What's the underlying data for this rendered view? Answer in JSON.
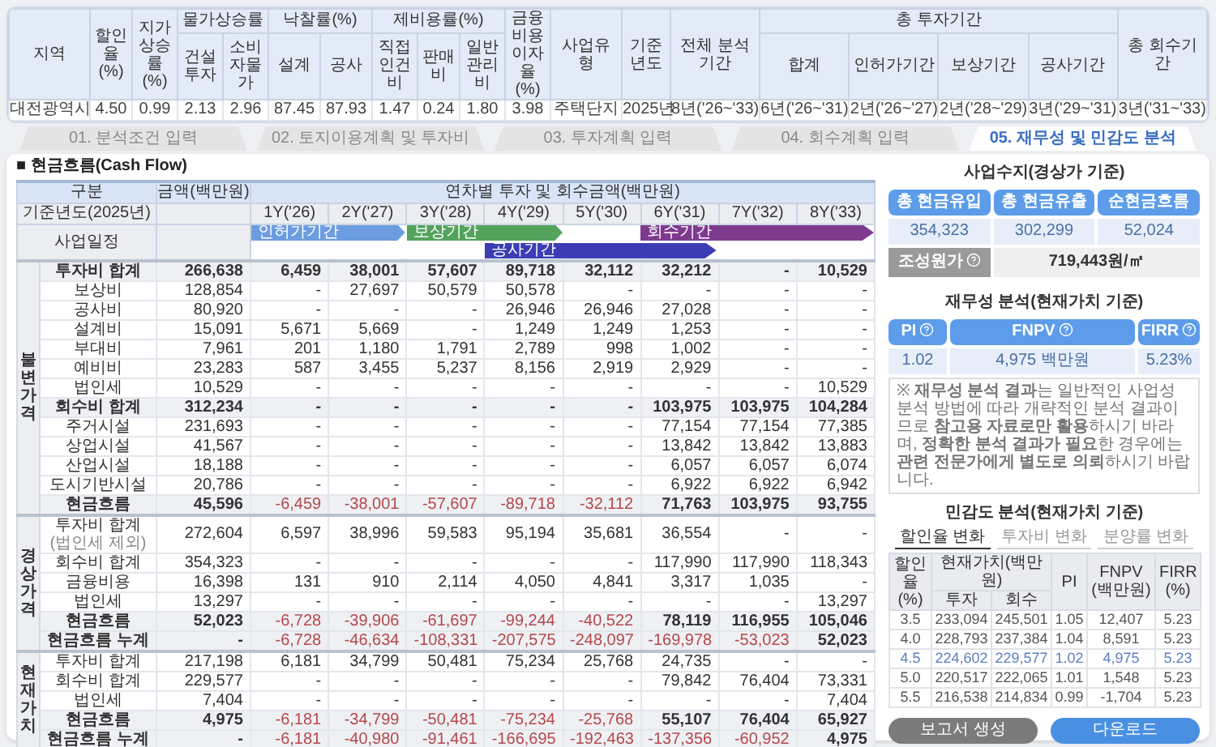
{
  "summary": {
    "columns": [
      {
        "label": "지역"
      },
      {
        "label": "할인율 (%)"
      },
      {
        "label": "지가상승률 (%)"
      },
      {
        "label": "물가상승률",
        "children": [
          "건설투자",
          "소비자물가"
        ]
      },
      {
        "label": "낙찰률(%)",
        "children": [
          "설계",
          "공사"
        ]
      },
      {
        "label": "제비용률(%)",
        "children": [
          "직접인건비",
          "판매비",
          "일반관리비"
        ]
      },
      {
        "label": "금융비용 이자율(%)"
      },
      {
        "label": "사업유형"
      },
      {
        "label": "기준 년도"
      },
      {
        "label": "전체 분석기간"
      },
      {
        "label": "총 투자기간",
        "children": [
          "합계",
          "인허가기간",
          "보상기간",
          "공사기간"
        ]
      },
      {
        "label": "총 회수기간"
      }
    ],
    "values": [
      "대전광역시",
      "4.50",
      "0.99",
      "2.13",
      "2.96",
      "87.45",
      "87.93",
      "1.47",
      "0.24",
      "1.80",
      "3.98",
      "주택단지",
      "2025년",
      "8년('26~'33)",
      "6년('26~'31)",
      "2년('26~'27)",
      "2년('28~'29)",
      "3년('29~'31)",
      "3년('31~'33)"
    ]
  },
  "steps": [
    {
      "label": "01. 분석조건 입력",
      "selected": false
    },
    {
      "label": "02. 토지이용계획 및 투자비",
      "selected": false
    },
    {
      "label": "03. 투자계획 입력",
      "selected": false
    },
    {
      "label": "04. 회수계획 입력",
      "selected": false
    },
    {
      "label": "05. 재무성 및 민감도 분석",
      "selected": true
    }
  ],
  "cash_flow": {
    "title": "■ 현금흐름(Cash Flow)",
    "category": "구분",
    "amount": "금액(백만원)",
    "yearly": "연차별 투자 및 회수금액(백만원)",
    "base_year": "기준년도(2025년)",
    "years": [
      "1Y('26)",
      "2Y('27)",
      "3Y('28)",
      "4Y('29)",
      "5Y('30)",
      "6Y('31)",
      "7Y('32)",
      "8Y('33)"
    ],
    "schedule": {
      "label": "사업일정",
      "bars": [
        {
          "label": "인허가기간",
          "kind": "permit"
        },
        {
          "label": "보상기간",
          "kind": "compensation"
        },
        {
          "label": "공사기간",
          "kind": "construction"
        },
        {
          "label": "회수기간",
          "kind": "supply"
        }
      ]
    },
    "groups": [
      {
        "label": "불변가격",
        "rows": [
          {
            "label": "투자비 합계",
            "kind": "subtotal",
            "amount": "266,638",
            "values": [
              "6,459",
              "38,001",
              "57,607",
              "89,718",
              "32,112",
              "32,212",
              "-",
              "10,529"
            ]
          },
          {
            "label": "보상비",
            "kind": "item",
            "amount": "128,854",
            "values": [
              "-",
              "27,697",
              "50,579",
              "50,578",
              "-",
              "-",
              "-",
              "-"
            ]
          },
          {
            "label": "공사비",
            "kind": "item",
            "amount": "80,920",
            "values": [
              "-",
              "-",
              "-",
              "26,946",
              "26,946",
              "27,028",
              "-",
              "-"
            ]
          },
          {
            "label": "설계비",
            "kind": "item",
            "amount": "15,091",
            "values": [
              "5,671",
              "5,669",
              "-",
              "1,249",
              "1,249",
              "1,253",
              "-",
              "-"
            ]
          },
          {
            "label": "부대비",
            "kind": "item",
            "amount": "7,961",
            "values": [
              "201",
              "1,180",
              "1,791",
              "2,789",
              "998",
              "1,002",
              "-",
              "-"
            ]
          },
          {
            "label": "예비비",
            "kind": "item",
            "amount": "23,283",
            "values": [
              "587",
              "3,455",
              "5,237",
              "8,156",
              "2,919",
              "2,929",
              "-",
              "-"
            ]
          },
          {
            "label": "법인세",
            "kind": "item",
            "amount": "10,529",
            "values": [
              "-",
              "-",
              "-",
              "-",
              "-",
              "-",
              "-",
              "10,529"
            ]
          },
          {
            "label": "회수비 합계",
            "kind": "subtotal",
            "amount": "312,234",
            "values": [
              "-",
              "-",
              "-",
              "-",
              "-",
              "103,975",
              "103,975",
              "104,284"
            ]
          },
          {
            "label": "주거시설",
            "kind": "item",
            "amount": "231,693",
            "values": [
              "-",
              "-",
              "-",
              "-",
              "-",
              "77,154",
              "77,154",
              "77,385"
            ]
          },
          {
            "label": "상업시설",
            "kind": "item",
            "amount": "41,567",
            "values": [
              "-",
              "-",
              "-",
              "-",
              "-",
              "13,842",
              "13,842",
              "13,883"
            ]
          },
          {
            "label": "산업시설",
            "kind": "item",
            "amount": "18,188",
            "values": [
              "-",
              "-",
              "-",
              "-",
              "-",
              "6,057",
              "6,057",
              "6,074"
            ]
          },
          {
            "label": "도시기반시설",
            "kind": "item",
            "amount": "20,786",
            "values": [
              "-",
              "-",
              "-",
              "-",
              "-",
              "6,922",
              "6,922",
              "6,942"
            ]
          },
          {
            "label": "현금흐름",
            "kind": "cashflow",
            "amount": "45,596",
            "values": [
              "-6,459",
              "-38,001",
              "-57,607",
              "-89,718",
              "-32,112",
              "71,763",
              "103,975",
              "93,755"
            ]
          }
        ]
      },
      {
        "label": "경상가격",
        "rows": [
          {
            "label": "투자비 합계",
            "note": "(법인세 제외)",
            "kind": "item",
            "amount": "272,604",
            "values": [
              "6,597",
              "38,996",
              "59,583",
              "95,194",
              "35,681",
              "36,554",
              "-",
              "-"
            ]
          },
          {
            "label": "회수비 합계",
            "kind": "item",
            "amount": "354,323",
            "values": [
              "-",
              "-",
              "-",
              "-",
              "-",
              "117,990",
              "117,990",
              "118,343"
            ]
          },
          {
            "label": "금융비용",
            "kind": "item",
            "amount": "16,398",
            "values": [
              "131",
              "910",
              "2,114",
              "4,050",
              "4,841",
              "3,317",
              "1,035",
              "-"
            ]
          },
          {
            "label": "법인세",
            "kind": "item",
            "amount": "13,297",
            "values": [
              "-",
              "-",
              "-",
              "-",
              "-",
              "-",
              "-",
              "13,297"
            ]
          },
          {
            "label": "현금흐름",
            "kind": "cashflow",
            "amount": "52,023",
            "values": [
              "-6,728",
              "-39,906",
              "-61,697",
              "-99,244",
              "-40,522",
              "78,119",
              "116,955",
              "105,046"
            ]
          },
          {
            "label": "현금흐름 누계",
            "kind": "cashflow",
            "amount": "-",
            "values": [
              "-6,728",
              "-46,634",
              "-108,331",
              "-207,575",
              "-248,097",
              "-169,978",
              "-53,023",
              "52,023"
            ]
          }
        ]
      },
      {
        "label": "현재가치",
        "rows": [
          {
            "label": "투자비 합계",
            "kind": "item",
            "amount": "217,198",
            "values": [
              "6,181",
              "34,799",
              "50,481",
              "75,234",
              "25,768",
              "24,735",
              "-",
              "-"
            ]
          },
          {
            "label": "회수비 합계",
            "kind": "item",
            "amount": "229,577",
            "values": [
              "-",
              "-",
              "-",
              "-",
              "-",
              "79,842",
              "76,404",
              "73,331"
            ]
          },
          {
            "label": "법인세",
            "kind": "item",
            "amount": "7,404",
            "values": [
              "-",
              "-",
              "-",
              "-",
              "-",
              "-",
              "-",
              "7,404"
            ]
          },
          {
            "label": "현금흐름",
            "kind": "cashflow",
            "amount": "4,975",
            "values": [
              "-6,181",
              "-34,799",
              "-50,481",
              "-75,234",
              "-25,768",
              "55,107",
              "76,404",
              "65,927"
            ]
          },
          {
            "label": "현금흐름 누계",
            "kind": "cashflow",
            "amount": "-",
            "values": [
              "-6,181",
              "-40,980",
              "-91,461",
              "-166,695",
              "-192,463",
              "-137,356",
              "-60,952",
              "4,975"
            ]
          }
        ]
      }
    ]
  },
  "balance": {
    "title": "사업수지(경상가 기준)",
    "headers": [
      "총 현금유입",
      "총 현금유출",
      "순현금흐름"
    ],
    "values": [
      "354,323",
      "302,299",
      "52,024"
    ],
    "cost": {
      "label": "조성원가",
      "value": "719,443원/㎡"
    }
  },
  "financial": {
    "title": "재무성 분석(현재가치 기준)",
    "items": [
      {
        "label": "PI",
        "value": "1.02"
      },
      {
        "label": "FNPV",
        "value": "4,975 백만원"
      },
      {
        "label": "FIRR",
        "value": "5.23%"
      }
    ],
    "note": "※ **재무성 분석 결과**는 일반적인 사업성 분석 방법에 따라 개략적인 분석 결과이므로 **참고용 자료로만 활용**하시기 바라며, **정확한 분석 결과가 필요**한 경우에는 **관련 전문가에게 별도로 의뢰**하시기 바랍니다."
  },
  "sensitivity": {
    "title": "민감도 분석(현재가치 기준)",
    "tabs": [
      {
        "label": "할인율 변화",
        "selected": true
      },
      {
        "label": "투자비 변화",
        "selected": false
      },
      {
        "label": "분양률 변화",
        "selected": false
      }
    ],
    "headers": {
      "rate": "할인율 (%)",
      "pv": "현재가치(백만원)",
      "invest": "투자",
      "recover": "회수",
      "pi": "PI",
      "fnpv": "FNPV (백만원)",
      "firr": "FIRR (%)"
    },
    "rows": [
      {
        "cells": [
          "3.5",
          "233,094",
          "245,501",
          "1.05",
          "12,407",
          "5.23"
        ],
        "selected": false
      },
      {
        "cells": [
          "4.0",
          "228,793",
          "237,384",
          "1.04",
          "8,591",
          "5.23"
        ],
        "selected": false
      },
      {
        "cells": [
          "4.5",
          "224,602",
          "229,577",
          "1.02",
          "4,975",
          "5.23"
        ],
        "selected": true
      },
      {
        "cells": [
          "5.0",
          "220,517",
          "222,065",
          "1.01",
          "1,548",
          "5.23"
        ],
        "selected": false
      },
      {
        "cells": [
          "5.5",
          "216,538",
          "214,834",
          "0.99",
          "-1,704",
          "5.23"
        ],
        "selected": false
      }
    ]
  },
  "buttons": [
    {
      "label": "보고서 생성",
      "kind": "secondary"
    },
    {
      "label": "다운로드",
      "kind": "primary"
    }
  ]
}
